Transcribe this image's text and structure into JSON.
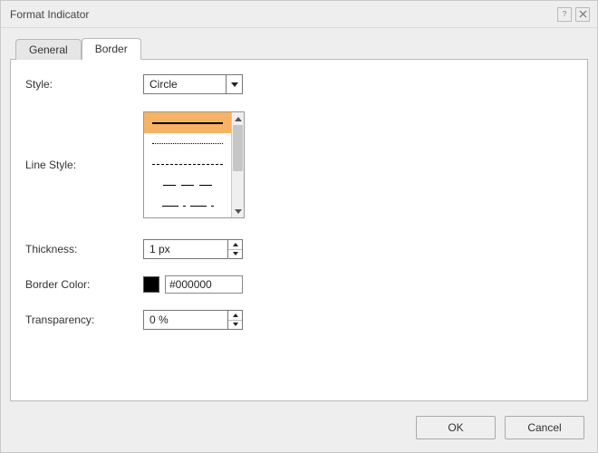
{
  "dialog": {
    "title": "Format Indicator",
    "help_icon": "?",
    "close_icon": "×"
  },
  "tabs": {
    "general": "General",
    "border": "Border",
    "active": "border"
  },
  "labels": {
    "style": "Style:",
    "line_style": "Line Style:",
    "thickness": "Thickness:",
    "border_color": "Border Color:",
    "transparency": "Transparency:"
  },
  "fields": {
    "style": {
      "value": "Circle",
      "options": [
        "Circle"
      ]
    },
    "line_style": {
      "selected_index": 0,
      "options": [
        "solid",
        "dotted",
        "dash-short",
        "dash-medium",
        "dash-long"
      ]
    },
    "thickness": {
      "value": "1 px"
    },
    "border_color": {
      "swatch": "#000000",
      "value": "#000000"
    },
    "transparency": {
      "value": "0 %"
    }
  },
  "buttons": {
    "ok": "OK",
    "cancel": "Cancel"
  }
}
